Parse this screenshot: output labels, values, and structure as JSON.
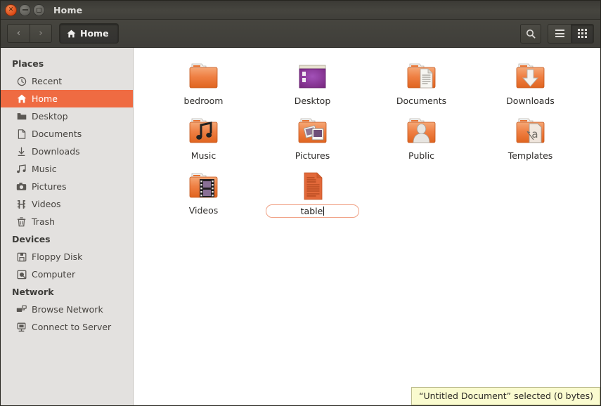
{
  "window": {
    "title": "Home",
    "controls": [
      {
        "name": "close",
        "glyph": "×"
      },
      {
        "name": "minimize",
        "glyph": "−"
      },
      {
        "name": "maximize",
        "glyph": "□"
      }
    ]
  },
  "toolbar": {
    "back_label": "‹",
    "forward_label": "›",
    "breadcrumb_label": "Home",
    "search_label": "Search",
    "list_view_label": "List view",
    "grid_view_label": "Icon view"
  },
  "sidebar": {
    "sections": [
      {
        "title": "Places",
        "items": [
          {
            "label": "Recent",
            "icon": "clock-icon",
            "selected": false
          },
          {
            "label": "Home",
            "icon": "home-icon",
            "selected": true
          },
          {
            "label": "Desktop",
            "icon": "desktop-icon",
            "selected": false
          },
          {
            "label": "Documents",
            "icon": "document-icon",
            "selected": false
          },
          {
            "label": "Downloads",
            "icon": "download-icon",
            "selected": false
          },
          {
            "label": "Music",
            "icon": "music-icon",
            "selected": false
          },
          {
            "label": "Pictures",
            "icon": "camera-icon",
            "selected": false
          },
          {
            "label": "Videos",
            "icon": "film-icon",
            "selected": false
          },
          {
            "label": "Trash",
            "icon": "trash-icon",
            "selected": false
          }
        ]
      },
      {
        "title": "Devices",
        "items": [
          {
            "label": "Floppy Disk",
            "icon": "floppy-icon",
            "selected": false
          },
          {
            "label": "Computer",
            "icon": "computer-icon",
            "selected": false
          }
        ]
      },
      {
        "title": "Network",
        "items": [
          {
            "label": "Browse Network",
            "icon": "network-icon",
            "selected": false
          },
          {
            "label": "Connect to Server",
            "icon": "server-icon",
            "selected": false
          }
        ]
      }
    ]
  },
  "files": [
    {
      "name": "bedroom",
      "icon": "folder-icon",
      "editing": false
    },
    {
      "name": "Desktop",
      "icon": "desktop-folder-icon",
      "editing": false
    },
    {
      "name": "Documents",
      "icon": "documents-folder-icon",
      "editing": false
    },
    {
      "name": "Downloads",
      "icon": "downloads-folder-icon",
      "editing": false
    },
    {
      "name": "Music",
      "icon": "music-folder-icon",
      "editing": false
    },
    {
      "name": "Pictures",
      "icon": "pictures-folder-icon",
      "editing": false
    },
    {
      "name": "Public",
      "icon": "public-folder-icon",
      "editing": false
    },
    {
      "name": "Templates",
      "icon": "templates-folder-icon",
      "editing": false
    },
    {
      "name": "Videos",
      "icon": "videos-folder-icon",
      "editing": false
    },
    {
      "name": "table",
      "icon": "text-document-icon",
      "editing": true
    }
  ],
  "status": {
    "text": "“Untitled Document” selected  (0 bytes)"
  },
  "colors": {
    "accent_orange": "#ef6b42",
    "titlebar_dark": "#413f3a",
    "sidebar_bg": "#e3e1df",
    "folder_orange": "#e8702c",
    "status_yellow": "#fafbcf"
  }
}
